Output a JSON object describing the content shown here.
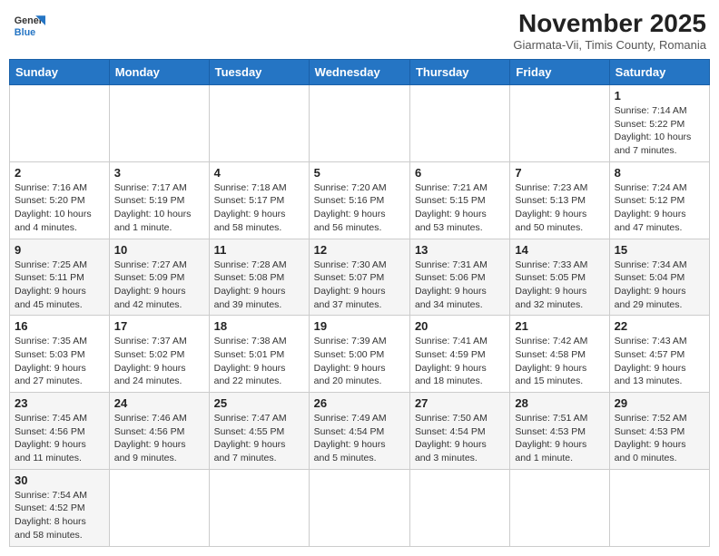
{
  "header": {
    "logo_line1": "General",
    "logo_line2": "Blue",
    "month_title": "November 2025",
    "subtitle": "Giarmata-Vii, Timis County, Romania"
  },
  "weekdays": [
    "Sunday",
    "Monday",
    "Tuesday",
    "Wednesday",
    "Thursday",
    "Friday",
    "Saturday"
  ],
  "weeks": [
    [
      {
        "day": "",
        "info": ""
      },
      {
        "day": "",
        "info": ""
      },
      {
        "day": "",
        "info": ""
      },
      {
        "day": "",
        "info": ""
      },
      {
        "day": "",
        "info": ""
      },
      {
        "day": "",
        "info": ""
      },
      {
        "day": "1",
        "info": "Sunrise: 7:14 AM\nSunset: 5:22 PM\nDaylight: 10 hours\nand 7 minutes."
      }
    ],
    [
      {
        "day": "2",
        "info": "Sunrise: 7:16 AM\nSunset: 5:20 PM\nDaylight: 10 hours\nand 4 minutes."
      },
      {
        "day": "3",
        "info": "Sunrise: 7:17 AM\nSunset: 5:19 PM\nDaylight: 10 hours\nand 1 minute."
      },
      {
        "day": "4",
        "info": "Sunrise: 7:18 AM\nSunset: 5:17 PM\nDaylight: 9 hours\nand 58 minutes."
      },
      {
        "day": "5",
        "info": "Sunrise: 7:20 AM\nSunset: 5:16 PM\nDaylight: 9 hours\nand 56 minutes."
      },
      {
        "day": "6",
        "info": "Sunrise: 7:21 AM\nSunset: 5:15 PM\nDaylight: 9 hours\nand 53 minutes."
      },
      {
        "day": "7",
        "info": "Sunrise: 7:23 AM\nSunset: 5:13 PM\nDaylight: 9 hours\nand 50 minutes."
      },
      {
        "day": "8",
        "info": "Sunrise: 7:24 AM\nSunset: 5:12 PM\nDaylight: 9 hours\nand 47 minutes."
      }
    ],
    [
      {
        "day": "9",
        "info": "Sunrise: 7:25 AM\nSunset: 5:11 PM\nDaylight: 9 hours\nand 45 minutes."
      },
      {
        "day": "10",
        "info": "Sunrise: 7:27 AM\nSunset: 5:09 PM\nDaylight: 9 hours\nand 42 minutes."
      },
      {
        "day": "11",
        "info": "Sunrise: 7:28 AM\nSunset: 5:08 PM\nDaylight: 9 hours\nand 39 minutes."
      },
      {
        "day": "12",
        "info": "Sunrise: 7:30 AM\nSunset: 5:07 PM\nDaylight: 9 hours\nand 37 minutes."
      },
      {
        "day": "13",
        "info": "Sunrise: 7:31 AM\nSunset: 5:06 PM\nDaylight: 9 hours\nand 34 minutes."
      },
      {
        "day": "14",
        "info": "Sunrise: 7:33 AM\nSunset: 5:05 PM\nDaylight: 9 hours\nand 32 minutes."
      },
      {
        "day": "15",
        "info": "Sunrise: 7:34 AM\nSunset: 5:04 PM\nDaylight: 9 hours\nand 29 minutes."
      }
    ],
    [
      {
        "day": "16",
        "info": "Sunrise: 7:35 AM\nSunset: 5:03 PM\nDaylight: 9 hours\nand 27 minutes."
      },
      {
        "day": "17",
        "info": "Sunrise: 7:37 AM\nSunset: 5:02 PM\nDaylight: 9 hours\nand 24 minutes."
      },
      {
        "day": "18",
        "info": "Sunrise: 7:38 AM\nSunset: 5:01 PM\nDaylight: 9 hours\nand 22 minutes."
      },
      {
        "day": "19",
        "info": "Sunrise: 7:39 AM\nSunset: 5:00 PM\nDaylight: 9 hours\nand 20 minutes."
      },
      {
        "day": "20",
        "info": "Sunrise: 7:41 AM\nSunset: 4:59 PM\nDaylight: 9 hours\nand 18 minutes."
      },
      {
        "day": "21",
        "info": "Sunrise: 7:42 AM\nSunset: 4:58 PM\nDaylight: 9 hours\nand 15 minutes."
      },
      {
        "day": "22",
        "info": "Sunrise: 7:43 AM\nSunset: 4:57 PM\nDaylight: 9 hours\nand 13 minutes."
      }
    ],
    [
      {
        "day": "23",
        "info": "Sunrise: 7:45 AM\nSunset: 4:56 PM\nDaylight: 9 hours\nand 11 minutes."
      },
      {
        "day": "24",
        "info": "Sunrise: 7:46 AM\nSunset: 4:56 PM\nDaylight: 9 hours\nand 9 minutes."
      },
      {
        "day": "25",
        "info": "Sunrise: 7:47 AM\nSunset: 4:55 PM\nDaylight: 9 hours\nand 7 minutes."
      },
      {
        "day": "26",
        "info": "Sunrise: 7:49 AM\nSunset: 4:54 PM\nDaylight: 9 hours\nand 5 minutes."
      },
      {
        "day": "27",
        "info": "Sunrise: 7:50 AM\nSunset: 4:54 PM\nDaylight: 9 hours\nand 3 minutes."
      },
      {
        "day": "28",
        "info": "Sunrise: 7:51 AM\nSunset: 4:53 PM\nDaylight: 9 hours\nand 1 minute."
      },
      {
        "day": "29",
        "info": "Sunrise: 7:52 AM\nSunset: 4:53 PM\nDaylight: 9 hours\nand 0 minutes."
      }
    ],
    [
      {
        "day": "30",
        "info": "Sunrise: 7:54 AM\nSunset: 4:52 PM\nDaylight: 8 hours\nand 58 minutes."
      },
      {
        "day": "",
        "info": ""
      },
      {
        "day": "",
        "info": ""
      },
      {
        "day": "",
        "info": ""
      },
      {
        "day": "",
        "info": ""
      },
      {
        "day": "",
        "info": ""
      },
      {
        "day": "",
        "info": ""
      }
    ]
  ]
}
